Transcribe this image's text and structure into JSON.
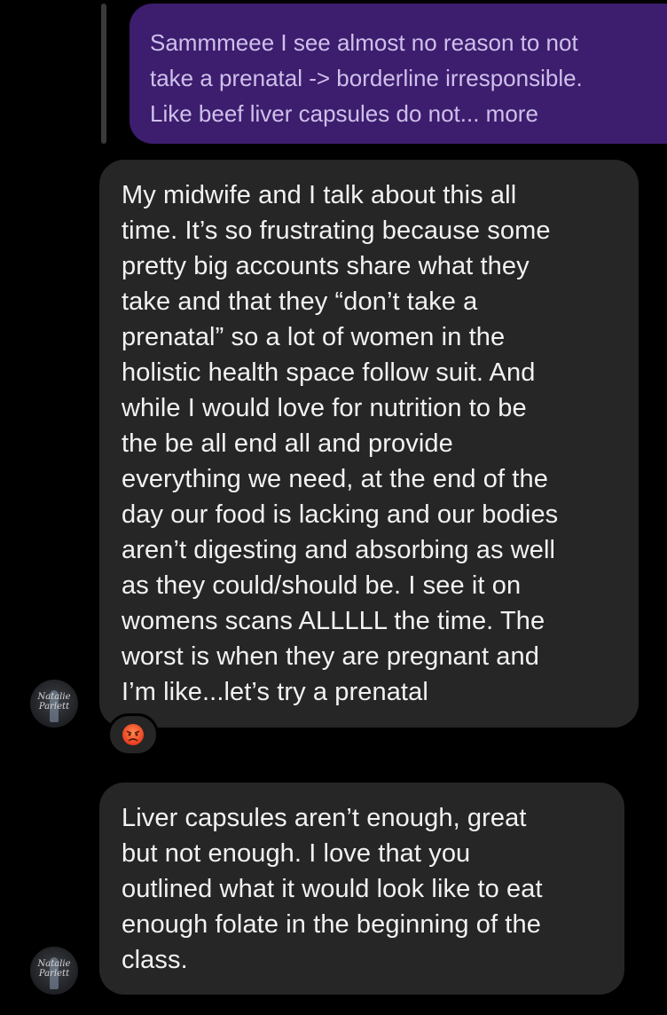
{
  "thread": {
    "quoted_message": {
      "text": "Sammmeee I see almost no reason to not\ntake a prenatal -> borderline irresponsible.\nLike beef liver capsules do not... more",
      "bubble_color": "#3d1d6e",
      "text_color": "#cec0ea"
    },
    "messages": [
      {
        "text": "My midwife and I talk about this all\ntime. It’s so frustrating because some\npretty big accounts share what they\ntake and that they “don’t take a\nprenatal” so a lot of women in the\nholistic health space follow suit. And\nwhile I would love for nutrition to be\nthe be all end all and provide\neverything we need, at the end of the\nday our food is lacking and our bodies\naren’t digesting and absorbing as well\nas they could/should be. I see it on\nwomens scans ALLLLL the time. The\nworst is when they are pregnant and\nI’m like...let’s try a prenatal",
        "reaction": "angry-face-emoji"
      },
      {
        "text": "Liver capsules aren’t enough, great\nbut not enough. I love that you\noutlined what it would look like to eat\nenough folate in the beginning of the\nclass."
      }
    ],
    "avatar": {
      "name": "Natalie\nParlett",
      "icon": "profile-avatar"
    },
    "colors": {
      "background": "#000000",
      "incoming_bubble": "#262626",
      "message_text": "#f2f2f2"
    }
  }
}
